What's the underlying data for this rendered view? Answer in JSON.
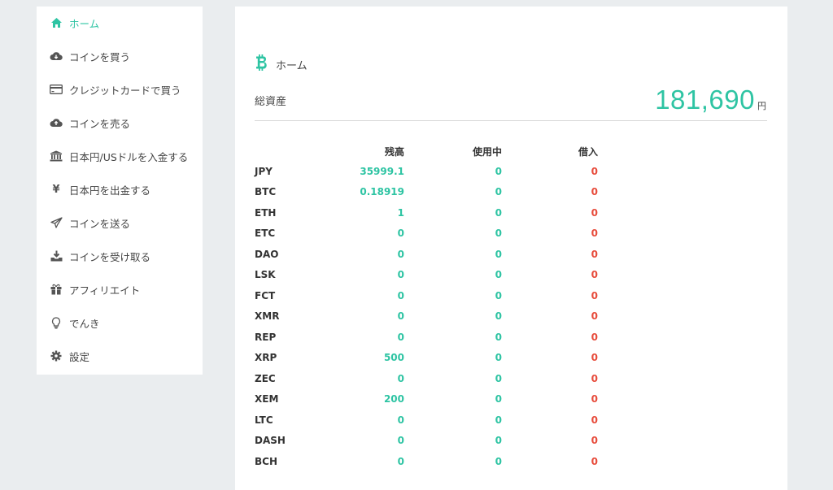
{
  "colors": {
    "accent": "#2ec4a3",
    "negative": "#e74c3c",
    "background": "#eaedef"
  },
  "sidebar": {
    "items": [
      {
        "label": "ホーム",
        "icon": "home-icon",
        "active": true
      },
      {
        "label": "コインを買う",
        "icon": "cloud-download-icon"
      },
      {
        "label": "クレジットカードで買う",
        "icon": "credit-card-icon"
      },
      {
        "label": "コインを売る",
        "icon": "cloud-upload-icon"
      },
      {
        "label": "日本円/USドルを入金する",
        "icon": "bank-icon"
      },
      {
        "label": "日本円を出金する",
        "icon": "yen-icon"
      },
      {
        "label": "コインを送る",
        "icon": "paper-plane-icon"
      },
      {
        "label": "コインを受け取る",
        "icon": "download-tray-icon"
      },
      {
        "label": "アフィリエイト",
        "icon": "gift-icon"
      },
      {
        "label": "でんき",
        "icon": "lightbulb-icon"
      },
      {
        "label": "設定",
        "icon": "gear-icon"
      }
    ]
  },
  "main": {
    "title": "ホーム",
    "title_icon": "bitcoin-icon",
    "total_label": "総資産",
    "total_value": "181,690",
    "total_unit": "円",
    "table": {
      "headers": {
        "balance": "残高",
        "in_use": "使用中",
        "borrowed": "借入"
      },
      "rows": [
        {
          "name": "JPY",
          "balance": "35999.1",
          "in_use": "0",
          "borrowed": "0"
        },
        {
          "name": "BTC",
          "balance": "0.18919",
          "in_use": "0",
          "borrowed": "0"
        },
        {
          "name": "ETH",
          "balance": "1",
          "in_use": "0",
          "borrowed": "0"
        },
        {
          "name": "ETC",
          "balance": "0",
          "in_use": "0",
          "borrowed": "0"
        },
        {
          "name": "DAO",
          "balance": "0",
          "in_use": "0",
          "borrowed": "0"
        },
        {
          "name": "LSK",
          "balance": "0",
          "in_use": "0",
          "borrowed": "0"
        },
        {
          "name": "FCT",
          "balance": "0",
          "in_use": "0",
          "borrowed": "0"
        },
        {
          "name": "XMR",
          "balance": "0",
          "in_use": "0",
          "borrowed": "0"
        },
        {
          "name": "REP",
          "balance": "0",
          "in_use": "0",
          "borrowed": "0"
        },
        {
          "name": "XRP",
          "balance": "500",
          "in_use": "0",
          "borrowed": "0"
        },
        {
          "name": "ZEC",
          "balance": "0",
          "in_use": "0",
          "borrowed": "0"
        },
        {
          "name": "XEM",
          "balance": "200",
          "in_use": "0",
          "borrowed": "0"
        },
        {
          "name": "LTC",
          "balance": "0",
          "in_use": "0",
          "borrowed": "0"
        },
        {
          "name": "DASH",
          "balance": "0",
          "in_use": "0",
          "borrowed": "0"
        },
        {
          "name": "BCH",
          "balance": "0",
          "in_use": "0",
          "borrowed": "0"
        }
      ]
    }
  }
}
